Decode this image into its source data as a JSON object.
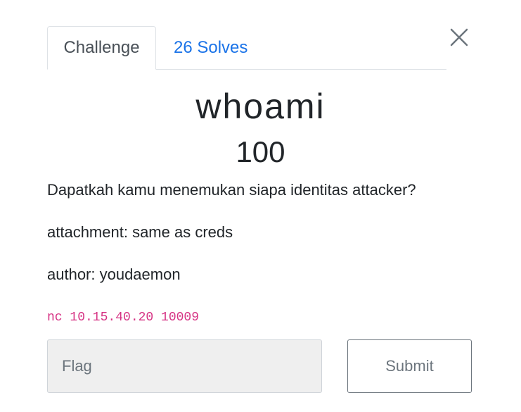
{
  "tabs": [
    {
      "label": "Challenge",
      "active": true
    },
    {
      "label": "26 Solves",
      "active": false
    }
  ],
  "close": {
    "icon": "close-icon"
  },
  "challenge": {
    "name": "whoami",
    "points": "100",
    "description": [
      "Dapatkah kamu menemukan siapa identitas attacker?",
      "attachment: same as creds",
      "author: youdaemon"
    ],
    "connection": "nc 10.15.40.20 10009"
  },
  "form": {
    "flag_placeholder": "Flag",
    "flag_value": "",
    "submit_label": "Submit"
  },
  "colors": {
    "link": "#1a73e8",
    "code": "#d63384",
    "input_bg": "#efefef",
    "button_border": "#6c757d"
  }
}
